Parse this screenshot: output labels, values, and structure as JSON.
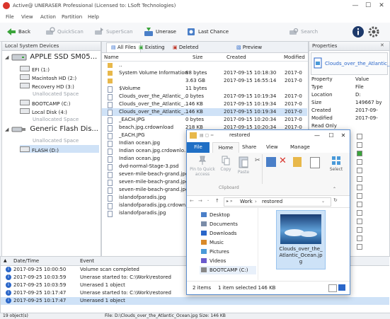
{
  "app": {
    "title": "Active@ UNERASER Professional (Licensed to: LSoft Technologies)"
  },
  "window": {
    "minimize": "—",
    "maximize": "☐",
    "close": "✕"
  },
  "menu": [
    "File",
    "View",
    "Action",
    "Partition",
    "Help"
  ],
  "toolbar": {
    "back": "Back",
    "quickscan": "QuickScan",
    "superscan": "SuperScan",
    "unerase": "Unerase",
    "lastchance": "Last Chance",
    "search": "Search"
  },
  "devices": {
    "header": "Local System Devices",
    "disk1": "APPLE SSD SM05...",
    "disk1_parts": [
      {
        "label": "EFI (1:)",
        "grey": false
      },
      {
        "label": "Macintosh HD (2:)",
        "grey": false
      },
      {
        "label": "Recovery HD (3:)",
        "grey": false
      },
      {
        "label": "Unallocated Space",
        "grey": true
      },
      {
        "label": "BOOTCAMP (C:)",
        "grey": false
      },
      {
        "label": "Local Disk (4:)",
        "grey": false
      },
      {
        "label": "Unallocated Space",
        "grey": true
      }
    ],
    "disk2": "Generic Flash Dis...",
    "disk2_parts": [
      {
        "label": "Unallocated Space",
        "grey": true
      },
      {
        "label": "FLASH (D:)",
        "grey": false
      }
    ]
  },
  "files": {
    "tabs": {
      "all": "All Files",
      "existing": "Existing",
      "deleted": "Deleted",
      "preview": "Preview"
    },
    "columns": {
      "name": "Name",
      "size": "Size",
      "created": "Created",
      "modified": "Modified"
    },
    "rows": [
      {
        "name": "..",
        "size": "",
        "created": "",
        "modified": ""
      },
      {
        "name": "System Volume Information",
        "size": "88 bytes",
        "created": "2017-09-15 10:18:30",
        "modified": "2017-0"
      },
      {
        "name": "",
        "size": "3.63 GB",
        "created": "2017-09-15 16:55:14",
        "modified": "2017-0"
      },
      {
        "name": "$Volume",
        "size": "11 bytes",
        "created": "",
        "modified": ""
      },
      {
        "name": "Clouds_over_the_Atlantic_...",
        "size": "0 bytes",
        "created": "2017-09-15 10:19:34",
        "modified": "2017-0"
      },
      {
        "name": "Clouds_over_the_Atlantic_...",
        "size": "146 KB",
        "created": "2017-09-15 10:19:34",
        "modified": "2017-0"
      },
      {
        "name": "Clouds_over_the_Atlantic_...",
        "size": "146 KB",
        "created": "2017-09-15 10:19:34",
        "modified": "2017-0"
      },
      {
        "name": "_EACH.JPG",
        "size": "0 bytes",
        "created": "2017-09-15 10:20:34",
        "modified": "2017-0"
      },
      {
        "name": "beach.jpg.crdownload",
        "size": "218 KB",
        "created": "2017-09-15 10:20:34",
        "modified": "2017-0"
      },
      {
        "name": "_EACH.JPG",
        "size": "",
        "created": "",
        "modified": ""
      },
      {
        "name": "Indian ocean.jpg",
        "size": "",
        "created": "",
        "modified": ""
      },
      {
        "name": "Indian ocean.jpg.crdownlo...",
        "size": "",
        "created": "",
        "modified": ""
      },
      {
        "name": "Indian ocean.jpg",
        "size": "",
        "created": "",
        "modified": ""
      },
      {
        "name": "dvd-normal-Stage-3.psd",
        "size": "",
        "created": "",
        "modified": ""
      },
      {
        "name": "seven-mile-beach-grand.jpg",
        "size": "",
        "created": "",
        "modified": ""
      },
      {
        "name": "seven-mile-beach-grand.jpg",
        "size": "",
        "created": "",
        "modified": ""
      },
      {
        "name": "seven-mile-beach-grand.jpg",
        "size": "",
        "created": "",
        "modified": ""
      },
      {
        "name": "islandofparadis.jpg",
        "size": "",
        "created": "",
        "modified": ""
      },
      {
        "name": "islandofparadis.jpg.crdown...",
        "size": "",
        "created": "",
        "modified": ""
      },
      {
        "name": "islandofparadis.jpg",
        "size": "",
        "created": "",
        "modified": ""
      }
    ]
  },
  "properties": {
    "header": "Properties",
    "filename": "Clouds_over_the_Atlantic_",
    "col_property": "Property",
    "col_value": "Value",
    "rows": [
      {
        "k": "Type",
        "v": "File"
      },
      {
        "k": "Location",
        "v": "D:"
      },
      {
        "k": "Size",
        "v": "149667 by"
      },
      {
        "k": "Created",
        "v": "2017-09-"
      },
      {
        "k": "Modified",
        "v": "2017-09-"
      },
      {
        "k": "Read Only",
        "v": ""
      }
    ]
  },
  "explorer": {
    "title": "restored",
    "ribbon_tabs": {
      "file": "File",
      "home": "Home",
      "share": "Share",
      "view": "View",
      "manage": "Manage"
    },
    "ribbon": {
      "pin": "Pin to Quick access",
      "copy": "Copy",
      "paste": "Paste",
      "select": "Select",
      "clipboard": "Clipboard"
    },
    "path": {
      "p1": "Work",
      "p2": "restored"
    },
    "nav": [
      "Desktop",
      "Documents",
      "Downloads",
      "Music",
      "Pictures",
      "Videos",
      "BOOTCAMP (C:)"
    ],
    "file_label": "Clouds_over_the_Atlantic_Ocean.jpg",
    "status": {
      "items": "2 items",
      "selected": "1 item selected 146 KB"
    }
  },
  "log": {
    "columns": {
      "datetime": "Date/Time",
      "event": "Event"
    },
    "rows": [
      {
        "dt": "2017-09-25 10:00:50",
        "ev": "Volume scan completed"
      },
      {
        "dt": "2017-09-25 10:03:59",
        "ev": "Unerase started to: C:\\Work\\restored"
      },
      {
        "dt": "2017-09-25 10:03:59",
        "ev": "Unerased 1 object"
      },
      {
        "dt": "2017-09-25 10:17:47",
        "ev": "Unerase started to: C:\\Work\\restored"
      },
      {
        "dt": "2017-09-25 10:17:47",
        "ev": "Unerased 1 object"
      }
    ]
  },
  "status": {
    "left": "19 object(s)",
    "right": "File: D:\\Clouds_over_the_Atlantic_Ocean.jpg Size: 146 KB"
  }
}
